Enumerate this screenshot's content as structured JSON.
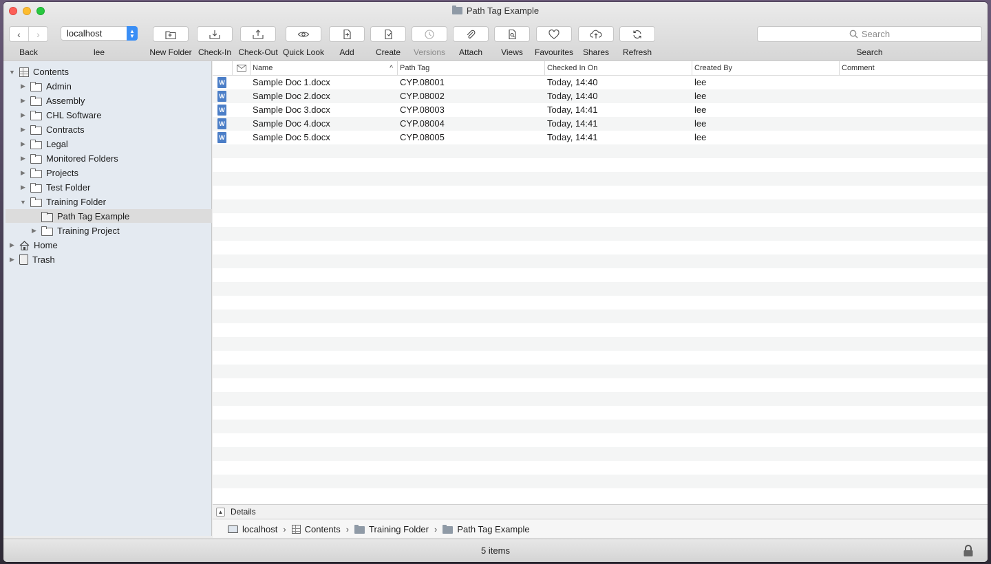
{
  "window": {
    "title": "Path Tag Example"
  },
  "toolbar": {
    "back_label": "Back",
    "server": {
      "value": "localhost",
      "user_label": "lee"
    },
    "tools": [
      {
        "id": "new-folder",
        "label": "New Folder",
        "icon": "new-folder-icon",
        "enabled": true
      },
      {
        "id": "check-in",
        "label": "Check-In",
        "icon": "check-in-icon",
        "enabled": true
      },
      {
        "id": "check-out",
        "label": "Check-Out",
        "icon": "check-out-icon",
        "enabled": true
      },
      {
        "id": "quick-look",
        "label": "Quick Look",
        "icon": "eye-icon",
        "enabled": true
      },
      {
        "id": "add",
        "label": "Add",
        "icon": "add-document-icon",
        "enabled": true
      },
      {
        "id": "create",
        "label": "Create",
        "icon": "create-document-icon",
        "enabled": true
      },
      {
        "id": "versions",
        "label": "Versions",
        "icon": "history-icon",
        "enabled": false
      },
      {
        "id": "attach",
        "label": "Attach",
        "icon": "paperclip-icon",
        "enabled": true
      },
      {
        "id": "views",
        "label": "Views",
        "icon": "views-icon",
        "enabled": true
      },
      {
        "id": "favourites",
        "label": "Favourites",
        "icon": "heart-icon",
        "enabled": true
      },
      {
        "id": "shares",
        "label": "Shares",
        "icon": "cloud-share-icon",
        "enabled": true
      },
      {
        "id": "refresh",
        "label": "Refresh",
        "icon": "refresh-icon",
        "enabled": true
      }
    ],
    "search": {
      "placeholder": "Search",
      "label": "Search"
    }
  },
  "sidebar": {
    "items": [
      {
        "label": "Contents",
        "level": 0,
        "icon": "grid-icon",
        "expanded": true
      },
      {
        "label": "Admin",
        "level": 1,
        "icon": "folder-icon",
        "expanded": false
      },
      {
        "label": "Assembly",
        "level": 1,
        "icon": "folder-icon",
        "expanded": false
      },
      {
        "label": "CHL Software",
        "level": 1,
        "icon": "folder-icon",
        "expanded": false
      },
      {
        "label": "Contracts",
        "level": 1,
        "icon": "folder-icon",
        "expanded": false
      },
      {
        "label": "Legal",
        "level": 1,
        "icon": "folder-icon",
        "expanded": false
      },
      {
        "label": "Monitored Folders",
        "level": 1,
        "icon": "folder-icon",
        "expanded": false
      },
      {
        "label": "Projects",
        "level": 1,
        "icon": "folder-icon",
        "expanded": false
      },
      {
        "label": "Test Folder",
        "level": 1,
        "icon": "folder-icon",
        "expanded": false
      },
      {
        "label": "Training Folder",
        "level": 1,
        "icon": "folder-icon",
        "expanded": true
      },
      {
        "label": "Path Tag Example",
        "level": 2,
        "icon": "folder-icon",
        "selected": true
      },
      {
        "label": "Training Project",
        "level": 2,
        "icon": "folder-icon",
        "expanded": false
      },
      {
        "label": "Home",
        "level": 0,
        "icon": "home-icon",
        "expanded": false
      },
      {
        "label": "Trash",
        "level": 0,
        "icon": "trash-icon",
        "expanded": false
      }
    ]
  },
  "table": {
    "columns": [
      "Name",
      "Path Tag",
      "Checked In On",
      "Created By",
      "Comment"
    ],
    "sort_indicator": "^",
    "rows": [
      {
        "name": "Sample Doc 1.docx",
        "path_tag": "CYP.08001",
        "checked_in_on": "Today, 14:40",
        "created_by": "lee",
        "comment": ""
      },
      {
        "name": "Sample Doc 2.docx",
        "path_tag": "CYP.08002",
        "checked_in_on": "Today, 14:40",
        "created_by": "lee",
        "comment": ""
      },
      {
        "name": "Sample Doc 3.docx",
        "path_tag": "CYP.08003",
        "checked_in_on": "Today, 14:41",
        "created_by": "lee",
        "comment": ""
      },
      {
        "name": "Sample Doc 4.docx",
        "path_tag": "CYP.08004",
        "checked_in_on": "Today, 14:41",
        "created_by": "lee",
        "comment": ""
      },
      {
        "name": "Sample Doc 5.docx",
        "path_tag": "CYP.08005",
        "checked_in_on": "Today, 14:41",
        "created_by": "lee",
        "comment": ""
      }
    ]
  },
  "details": {
    "label": "Details"
  },
  "pathbar": {
    "segments": [
      "localhost",
      "Contents",
      "Training Folder",
      "Path Tag Example"
    ],
    "separator": "›"
  },
  "status": {
    "text": "5 items"
  },
  "colors": {
    "accent": "#3a8ef5",
    "sidebar_bg": "#e4eaf1",
    "doc_icon": "#4b7ec7"
  }
}
